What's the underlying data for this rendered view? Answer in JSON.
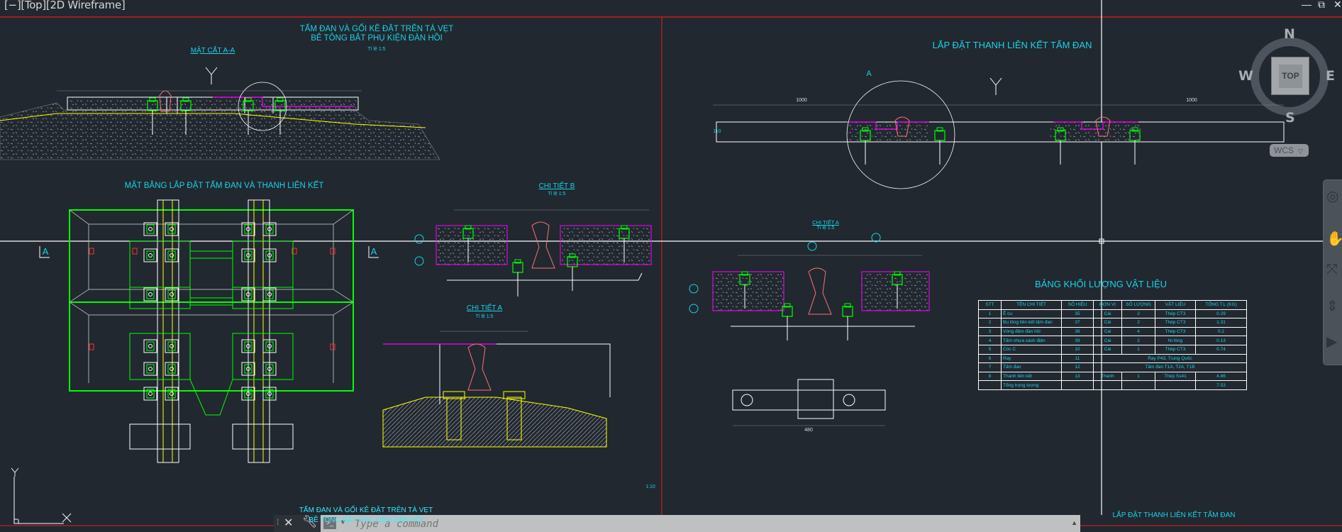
{
  "viewport": {
    "label": "[−][Top][2D Wireframe]"
  },
  "window_controls": {
    "minimize": "—",
    "restore": "⧉",
    "close": "✕"
  },
  "navcube": {
    "north": "N",
    "south": "S",
    "east": "E",
    "west": "W",
    "face": "TOP",
    "ucs": "WCS"
  },
  "command_line": {
    "placeholder": "Type a command",
    "close_icon": "close-icon",
    "customize_icon": "wrench-icon"
  },
  "drawing": {
    "title_left_1": "TẤM ĐAN VÀ GỐI KÊ ĐẶT TRÊN TÀ VẸT",
    "title_left_2": "BÊ TÔNG BẮT PHỤ KIỆN ĐÀN HỒI",
    "scale_1_5": "Tỉ lệ 1:5",
    "section_aa": "MẶT CẮT A-A",
    "title_right": "LẮP ĐẶT THANH LIÊN KẾT TẤM ĐAN",
    "plan_title": "MẶT BẰNG LẮP ĐẶT TẤM ĐAN VÀ THANH LIÊN KẾT",
    "detail_b": "CHI TIẾT B",
    "detail_a": "CHI TIẾT A",
    "section_mark": "A",
    "scale_1_10": "1:10",
    "bottom_title_left_1": "TẤM ĐAN VÀ GỐI KÊ ĐẶT TRÊN TÀ VẸT",
    "bottom_title_left_2": "BÊ TÔNG BẮT PHỤ KIỆN ĐÀN HỒI",
    "bottom_title_right": "LẮP ĐẶT THANH LIÊN KẾT TẤM ĐAN",
    "dim_1000": "1000",
    "dim_110": "110",
    "dim_480": "480"
  },
  "bom": {
    "title": "BẢNG KHỐI LƯỢNG VẬT LIỆU",
    "headers": [
      "STT",
      "TÊN CHI TIẾT",
      "SỐ HIỆU",
      "ĐƠN VỊ",
      "SỐ LƯỢNG",
      "VẬT LIỆU",
      "TỔNG T.L (KG)"
    ],
    "rows": [
      [
        "1",
        "Ê cu",
        "35",
        "Cái",
        "2",
        "Thép CT3",
        "0.29"
      ],
      [
        "2",
        "Bu lông liên kết tấm đan",
        "37",
        "Cái",
        "2",
        "Thép CT3",
        "1.31"
      ],
      [
        "3",
        "Vòng đệm đàn hồi",
        "36",
        "Cái",
        "4",
        "Thép CT3",
        "0.2"
      ],
      [
        "4",
        "Tấm nhựa cách điện",
        "39",
        "Cái",
        "2",
        "Ni lông",
        "0.13"
      ],
      [
        "5",
        "Cóc C",
        "10",
        "Cái",
        "1",
        "Thép CT3",
        "0.74"
      ],
      [
        "6",
        "Ray",
        "11",
        "Ray P43, Trung Quốc",
        "",
        "",
        ""
      ],
      [
        "7",
        "Tấm đan",
        "12",
        "Tấm đan T1A, T2A, T1B",
        "",
        "",
        ""
      ],
      [
        "8",
        "Thanh liên kết",
        "13",
        "Thanh",
        "1",
        "Thép Ss41",
        "4.86"
      ],
      [
        "",
        "Tổng trọng lượng",
        "",
        "",
        "",
        "",
        "7.53"
      ]
    ]
  },
  "colors": {
    "background": "#212830",
    "annotation": "#19d3e6",
    "green": "#00ff00",
    "magenta": "#ff00ff",
    "rail": "#ff7070",
    "yellow": "#ffff00"
  }
}
